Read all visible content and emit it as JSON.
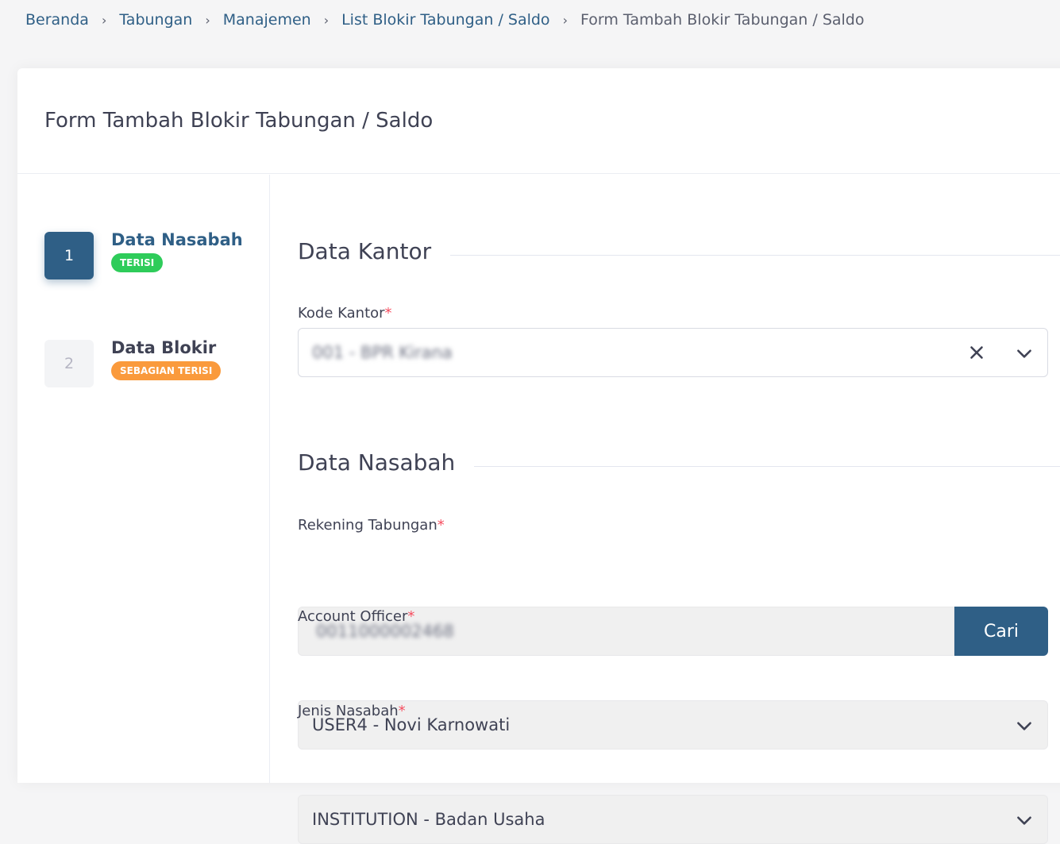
{
  "breadcrumb": {
    "items": [
      "Beranda",
      "Tabungan",
      "Manajemen",
      "List Blokir Tabungan / Saldo"
    ],
    "current": "Form Tambah Blokir Tabungan / Saldo",
    "separator": "›"
  },
  "card": {
    "title": "Form Tambah Blokir Tabungan / Saldo"
  },
  "steps": [
    {
      "number": "1",
      "title": "Data Nasabah",
      "badge": "TERISI",
      "badge_color": "#2ecc5a",
      "active": true
    },
    {
      "number": "2",
      "title": "Data Blokir",
      "badge": "SEBAGIAN TERISI",
      "badge_color": "#fa9a3c",
      "active": false
    }
  ],
  "sections": {
    "kantor": {
      "title": "Data Kantor",
      "kode_kantor": {
        "label": "Kode Kantor",
        "required": "*",
        "value": "001 - BPR Kirana"
      }
    },
    "nasabah": {
      "title": "Data Nasabah",
      "rekening": {
        "label": "Rekening Tabungan",
        "required": "*",
        "value": "0011000002468",
        "button": "Cari"
      },
      "account_officer": {
        "label": "Account Officer",
        "required": "*",
        "value": "USER4 - Novi Karnowati"
      },
      "jenis_nasabah": {
        "label": "Jenis Nasabah",
        "required": "*",
        "value": "INSTITUTION - Badan Usaha"
      }
    }
  },
  "colors": {
    "primary": "#2f5f86",
    "required": "#f64e60"
  }
}
